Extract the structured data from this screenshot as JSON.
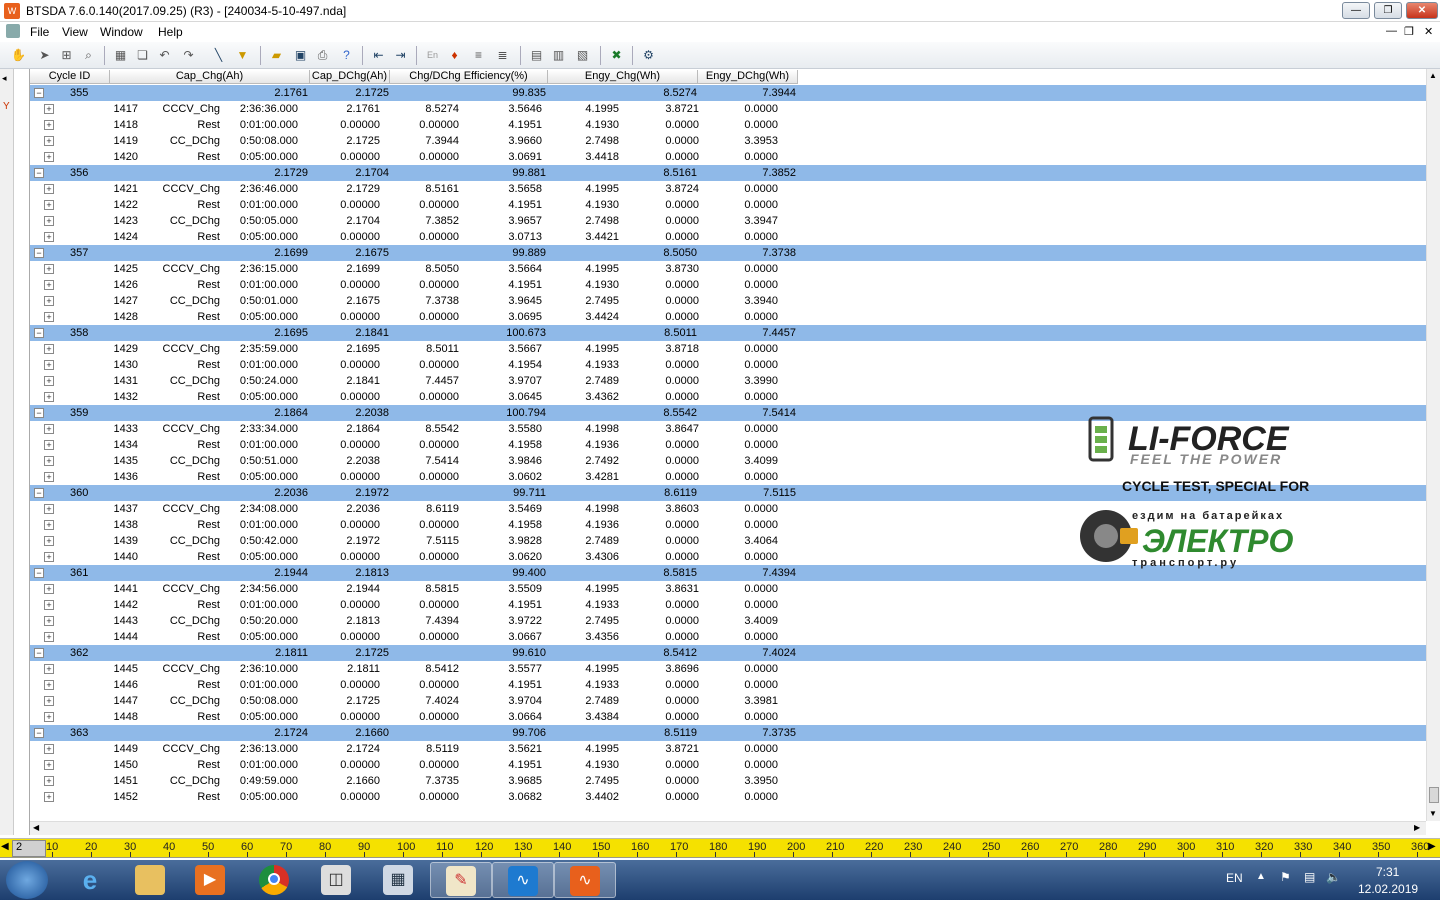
{
  "window": {
    "title": "BTSDA 7.6.0.140(2017.09.25) (R3) - [240034-5-10-497.nda]",
    "app_icon": "btsda-app-icon"
  },
  "menu": [
    "File",
    "View",
    "Window",
    "Help"
  ],
  "columns": [
    "Cycle ID",
    "Cap_Chg(Ah)",
    "Cap_DChg(Ah)",
    "Chg/DChg Efficiency(%)",
    "Engy_Chg(Wh)",
    "Engy_DChg(Wh)"
  ],
  "cycles": [
    {
      "id": "355",
      "cap_chg": "2.1761",
      "cap_dchg": "2.1725",
      "eff": "99.835",
      "engy_chg": "8.5274",
      "engy_dchg": "7.3944",
      "steps": [
        [
          "1417",
          "CCCV_Chg",
          "2:36:36.000",
          "2.1761",
          "8.5274",
          "3.5646",
          "4.1995",
          "3.8721",
          "0.0000",
          "0.0000"
        ],
        [
          "1418",
          "Rest",
          "0:01:00.000",
          "0.00000",
          "0.00000",
          "4.1951",
          "4.1930",
          "0.0000",
          "0.0000",
          ""
        ],
        [
          "1419",
          "CC_DChg",
          "0:50:08.000",
          "2.1725",
          "7.3944",
          "3.9660",
          "2.7498",
          "0.0000",
          "3.3953",
          ""
        ],
        [
          "1420",
          "Rest",
          "0:05:00.000",
          "0.00000",
          "0.00000",
          "3.0691",
          "3.4418",
          "0.0000",
          "0.0000",
          ""
        ]
      ]
    },
    {
      "id": "356",
      "cap_chg": "2.1729",
      "cap_dchg": "2.1704",
      "eff": "99.881",
      "engy_chg": "8.5161",
      "engy_dchg": "7.3852",
      "steps": [
        [
          "1421",
          "CCCV_Chg",
          "2:36:46.000",
          "2.1729",
          "8.5161",
          "3.5658",
          "4.1995",
          "3.8724",
          "0.0000",
          ""
        ],
        [
          "1422",
          "Rest",
          "0:01:00.000",
          "0.00000",
          "0.00000",
          "4.1951",
          "4.1930",
          "0.0000",
          "0.0000",
          ""
        ],
        [
          "1423",
          "CC_DChg",
          "0:50:05.000",
          "2.1704",
          "7.3852",
          "3.9657",
          "2.7498",
          "0.0000",
          "3.3947",
          ""
        ],
        [
          "1424",
          "Rest",
          "0:05:00.000",
          "0.00000",
          "0.00000",
          "3.0713",
          "3.4421",
          "0.0000",
          "0.0000",
          ""
        ]
      ]
    },
    {
      "id": "357",
      "cap_chg": "2.1699",
      "cap_dchg": "2.1675",
      "eff": "99.889",
      "engy_chg": "8.5050",
      "engy_dchg": "7.3738",
      "steps": [
        [
          "1425",
          "CCCV_Chg",
          "2:36:15.000",
          "2.1699",
          "8.5050",
          "3.5664",
          "4.1995",
          "3.8730",
          "0.0000",
          ""
        ],
        [
          "1426",
          "Rest",
          "0:01:00.000",
          "0.00000",
          "0.00000",
          "4.1951",
          "4.1930",
          "0.0000",
          "0.0000",
          ""
        ],
        [
          "1427",
          "CC_DChg",
          "0:50:01.000",
          "2.1675",
          "7.3738",
          "3.9645",
          "2.7495",
          "0.0000",
          "3.3940",
          ""
        ],
        [
          "1428",
          "Rest",
          "0:05:00.000",
          "0.00000",
          "0.00000",
          "3.0695",
          "3.4424",
          "0.0000",
          "0.0000",
          ""
        ]
      ]
    },
    {
      "id": "358",
      "cap_chg": "2.1695",
      "cap_dchg": "2.1841",
      "eff": "100.673",
      "engy_chg": "8.5011",
      "engy_dchg": "7.4457",
      "steps": [
        [
          "1429",
          "CCCV_Chg",
          "2:35:59.000",
          "2.1695",
          "8.5011",
          "3.5667",
          "4.1995",
          "3.8718",
          "0.0000",
          ""
        ],
        [
          "1430",
          "Rest",
          "0:01:00.000",
          "0.00000",
          "0.00000",
          "4.1954",
          "4.1933",
          "0.0000",
          "0.0000",
          ""
        ],
        [
          "1431",
          "CC_DChg",
          "0:50:24.000",
          "2.1841",
          "7.4457",
          "3.9707",
          "2.7489",
          "0.0000",
          "3.3990",
          ""
        ],
        [
          "1432",
          "Rest",
          "0:05:00.000",
          "0.00000",
          "0.00000",
          "3.0645",
          "3.4362",
          "0.0000",
          "0.0000",
          ""
        ]
      ]
    },
    {
      "id": "359",
      "cap_chg": "2.1864",
      "cap_dchg": "2.2038",
      "eff": "100.794",
      "engy_chg": "8.5542",
      "engy_dchg": "7.5414",
      "steps": [
        [
          "1433",
          "CCCV_Chg",
          "2:33:34.000",
          "2.1864",
          "8.5542",
          "3.5580",
          "4.1998",
          "3.8647",
          "0.0000",
          ""
        ],
        [
          "1434",
          "Rest",
          "0:01:00.000",
          "0.00000",
          "0.00000",
          "4.1958",
          "4.1936",
          "0.0000",
          "0.0000",
          ""
        ],
        [
          "1435",
          "CC_DChg",
          "0:50:51.000",
          "2.2038",
          "7.5414",
          "3.9846",
          "2.7492",
          "0.0000",
          "3.4099",
          ""
        ],
        [
          "1436",
          "Rest",
          "0:05:00.000",
          "0.00000",
          "0.00000",
          "3.0602",
          "3.4281",
          "0.0000",
          "0.0000",
          ""
        ]
      ]
    },
    {
      "id": "360",
      "cap_chg": "2.2036",
      "cap_dchg": "2.1972",
      "eff": "99.711",
      "engy_chg": "8.6119",
      "engy_dchg": "7.5115",
      "steps": [
        [
          "1437",
          "CCCV_Chg",
          "2:34:08.000",
          "2.2036",
          "8.6119",
          "3.5469",
          "4.1998",
          "3.8603",
          "0.0000",
          ""
        ],
        [
          "1438",
          "Rest",
          "0:01:00.000",
          "0.00000",
          "0.00000",
          "4.1958",
          "4.1936",
          "0.0000",
          "0.0000",
          ""
        ],
        [
          "1439",
          "CC_DChg",
          "0:50:42.000",
          "2.1972",
          "7.5115",
          "3.9828",
          "2.7489",
          "0.0000",
          "3.4064",
          ""
        ],
        [
          "1440",
          "Rest",
          "0:05:00.000",
          "0.00000",
          "0.00000",
          "3.0620",
          "3.4306",
          "0.0000",
          "0.0000",
          ""
        ]
      ]
    },
    {
      "id": "361",
      "cap_chg": "2.1944",
      "cap_dchg": "2.1813",
      "eff": "99.400",
      "engy_chg": "8.5815",
      "engy_dchg": "7.4394",
      "steps": [
        [
          "1441",
          "CCCV_Chg",
          "2:34:56.000",
          "2.1944",
          "8.5815",
          "3.5509",
          "4.1995",
          "3.8631",
          "0.0000",
          ""
        ],
        [
          "1442",
          "Rest",
          "0:01:00.000",
          "0.00000",
          "0.00000",
          "4.1951",
          "4.1933",
          "0.0000",
          "0.0000",
          ""
        ],
        [
          "1443",
          "CC_DChg",
          "0:50:20.000",
          "2.1813",
          "7.4394",
          "3.9722",
          "2.7495",
          "0.0000",
          "3.4009",
          ""
        ],
        [
          "1444",
          "Rest",
          "0:05:00.000",
          "0.00000",
          "0.00000",
          "3.0667",
          "3.4356",
          "0.0000",
          "0.0000",
          ""
        ]
      ]
    },
    {
      "id": "362",
      "cap_chg": "2.1811",
      "cap_dchg": "2.1725",
      "eff": "99.610",
      "engy_chg": "8.5412",
      "engy_dchg": "7.4024",
      "steps": [
        [
          "1445",
          "CCCV_Chg",
          "2:36:10.000",
          "2.1811",
          "8.5412",
          "3.5577",
          "4.1995",
          "3.8696",
          "0.0000",
          ""
        ],
        [
          "1446",
          "Rest",
          "0:01:00.000",
          "0.00000",
          "0.00000",
          "4.1951",
          "4.1933",
          "0.0000",
          "0.0000",
          ""
        ],
        [
          "1447",
          "CC_DChg",
          "0:50:08.000",
          "2.1725",
          "7.4024",
          "3.9704",
          "2.7489",
          "0.0000",
          "3.3981",
          ""
        ],
        [
          "1448",
          "Rest",
          "0:05:00.000",
          "0.00000",
          "0.00000",
          "3.0664",
          "3.4384",
          "0.0000",
          "0.0000",
          ""
        ]
      ]
    },
    {
      "id": "363",
      "cap_chg": "2.1724",
      "cap_dchg": "2.1660",
      "eff": "99.706",
      "engy_chg": "8.5119",
      "engy_dchg": "7.3735",
      "steps": [
        [
          "1449",
          "CCCV_Chg",
          "2:36:13.000",
          "2.1724",
          "8.5119",
          "3.5621",
          "4.1995",
          "3.8721",
          "0.0000",
          ""
        ],
        [
          "1450",
          "Rest",
          "0:01:00.000",
          "0.00000",
          "0.00000",
          "4.1951",
          "4.1930",
          "0.0000",
          "0.0000",
          ""
        ],
        [
          "1451",
          "CC_DChg",
          "0:49:59.000",
          "2.1660",
          "7.3735",
          "3.9685",
          "2.7495",
          "0.0000",
          "3.3950",
          ""
        ],
        [
          "1452",
          "Rest",
          "0:05:00.000",
          "0.00000",
          "0.00000",
          "3.0682",
          "3.4402",
          "0.0000",
          "0.0000",
          ""
        ]
      ]
    }
  ],
  "watermark": {
    "brand": "LI-FORCE",
    "tagline": "FEEL THE POWER",
    "caption": "CYCLE TEST, SPECIAL FOR",
    "partner_top": "ездим на батарейках",
    "partner_main": "ЭЛЕКТРО",
    "partner_bottom": "транспорт.ру"
  },
  "ruler": {
    "start": "2",
    "labels": [
      "10",
      "20",
      "30",
      "40",
      "50",
      "60",
      "70",
      "80",
      "90",
      "100",
      "110",
      "120",
      "130",
      "140",
      "150",
      "160",
      "170",
      "180",
      "190",
      "200",
      "210",
      "220",
      "230",
      "240",
      "250",
      "260",
      "270",
      "280",
      "290",
      "300",
      "310",
      "320",
      "330",
      "340",
      "350",
      "360"
    ]
  },
  "taskbar": {
    "apps": [
      "start-orb",
      "internet-explorer-icon",
      "file-explorer-icon",
      "media-player-icon",
      "chrome-icon",
      "package-icon",
      "calculator-icon",
      "paint-icon",
      "btsda-chart-icon",
      "btsda-app-icon"
    ],
    "lang": "EN",
    "time": "7:31",
    "date": "12.02.2019"
  },
  "colors": {
    "cycle_row": "#8fb9e8",
    "ruler": "#f5e100",
    "app_accent": "#e8601c"
  }
}
